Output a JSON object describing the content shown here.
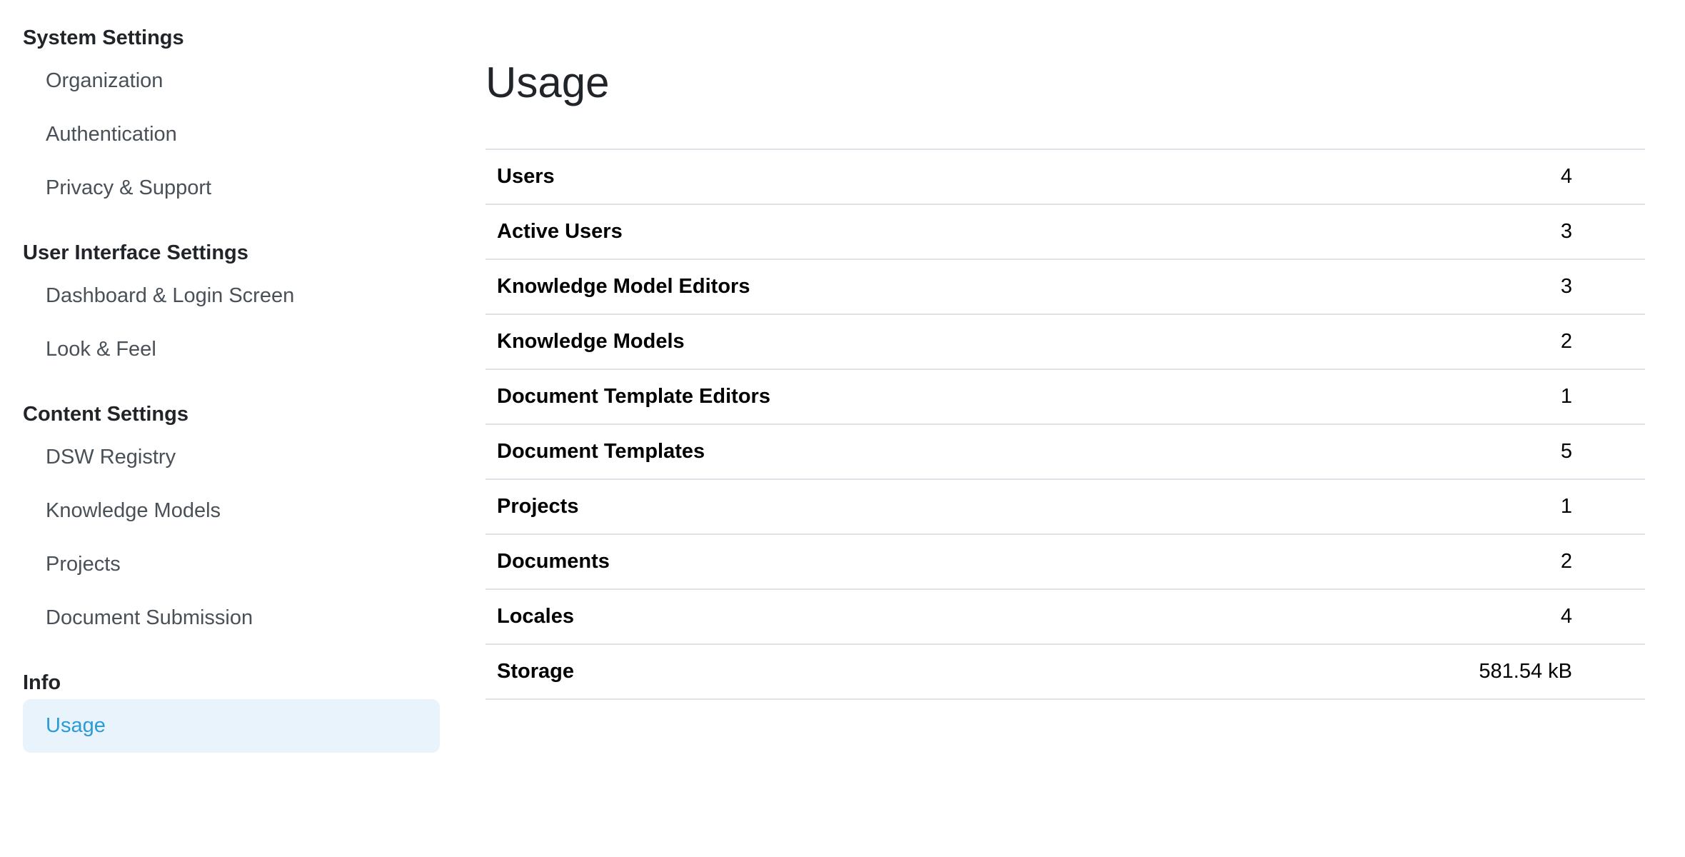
{
  "sidebar": {
    "sections": [
      {
        "title": "System Settings",
        "items": [
          "Organization",
          "Authentication",
          "Privacy & Support"
        ]
      },
      {
        "title": "User Interface Settings",
        "items": [
          "Dashboard & Login Screen",
          "Look & Feel"
        ]
      },
      {
        "title": "Content Settings",
        "items": [
          "DSW Registry",
          "Knowledge Models",
          "Projects",
          "Document Submission"
        ]
      },
      {
        "title": "Info",
        "items": [
          "Usage"
        ]
      }
    ],
    "active_item": "Usage"
  },
  "main": {
    "title": "Usage",
    "rows": [
      {
        "label": "Users",
        "value": "4"
      },
      {
        "label": "Active Users",
        "value": "3"
      },
      {
        "label": "Knowledge Model Editors",
        "value": "3"
      },
      {
        "label": "Knowledge Models",
        "value": "2"
      },
      {
        "label": "Document Template Editors",
        "value": "1"
      },
      {
        "label": "Document Templates",
        "value": "5"
      },
      {
        "label": "Projects",
        "value": "1"
      },
      {
        "label": "Documents",
        "value": "2"
      },
      {
        "label": "Locales",
        "value": "4"
      },
      {
        "label": "Storage",
        "value": "581.54 kB"
      }
    ]
  },
  "colors": {
    "active_bg": "#e8f3fb",
    "active_text": "#2b9bd6",
    "nav_text": "#495057",
    "border": "#dee2e6"
  }
}
